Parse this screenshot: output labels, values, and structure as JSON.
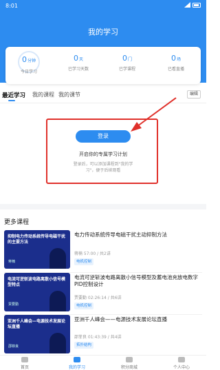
{
  "status_bar": {
    "time": "8:01"
  },
  "header": {
    "title": "我的学习"
  },
  "stats": [
    {
      "value": "0",
      "unit": "分钟",
      "label": "今日学习"
    },
    {
      "value": "0",
      "unit": "天",
      "label": "已学习天数"
    },
    {
      "value": "0",
      "unit": "门",
      "label": "已学课程"
    },
    {
      "value": "0",
      "unit": "场",
      "label": "已看直播"
    }
  ],
  "tabs": [
    {
      "label": "最近学习"
    },
    {
      "label": "我的课程"
    },
    {
      "label": "我的课节"
    }
  ],
  "edit_label": "编辑",
  "login": {
    "button": "登录",
    "subtitle": "开启你的专属学习计划",
    "desc": "登录后，可以添加课程到\"我的学习\"，便于后续观看"
  },
  "more_courses_title": "更多课程",
  "courses": [
    {
      "thumb_title": "抑制电力传动系统传导电磁干扰的主要方法",
      "thumb_speaker": "蒋楠",
      "title": "电力传动系统传导电磁干扰主动抑制方法",
      "meta": "蒋楠 57:00 / 共2讲",
      "tag": "电机控制"
    },
    {
      "thumb_title": "电流可逆斩波电路离散小信号模型特点",
      "thumb_speaker": "贾要勤",
      "title": "电流可逆斩波电路离散小信号模型及蓄电池充放电数字 PID控制设计",
      "meta": "贾要勤 02:26:14 / 共6讲",
      "tag": "电机控制"
    },
    {
      "thumb_title": "亚洲千人峰会—电源技术发展论坛直播",
      "thumb_speaker": "邵菲良",
      "title": "亚洲千人峰会——电源技术发展论坛直播",
      "meta": "邵菲良 01:43:39 / 共4讲",
      "tag": "拓扑结构"
    }
  ],
  "tabbar": [
    {
      "label": "首页",
      "icon": "home-icon"
    },
    {
      "label": "我的学习",
      "icon": "study-icon"
    },
    {
      "label": "积分商城",
      "icon": "shop-icon"
    },
    {
      "label": "个人中心",
      "icon": "profile-icon"
    }
  ],
  "colors": {
    "brand": "#2d8cf0",
    "highlight": "#e0302a"
  }
}
